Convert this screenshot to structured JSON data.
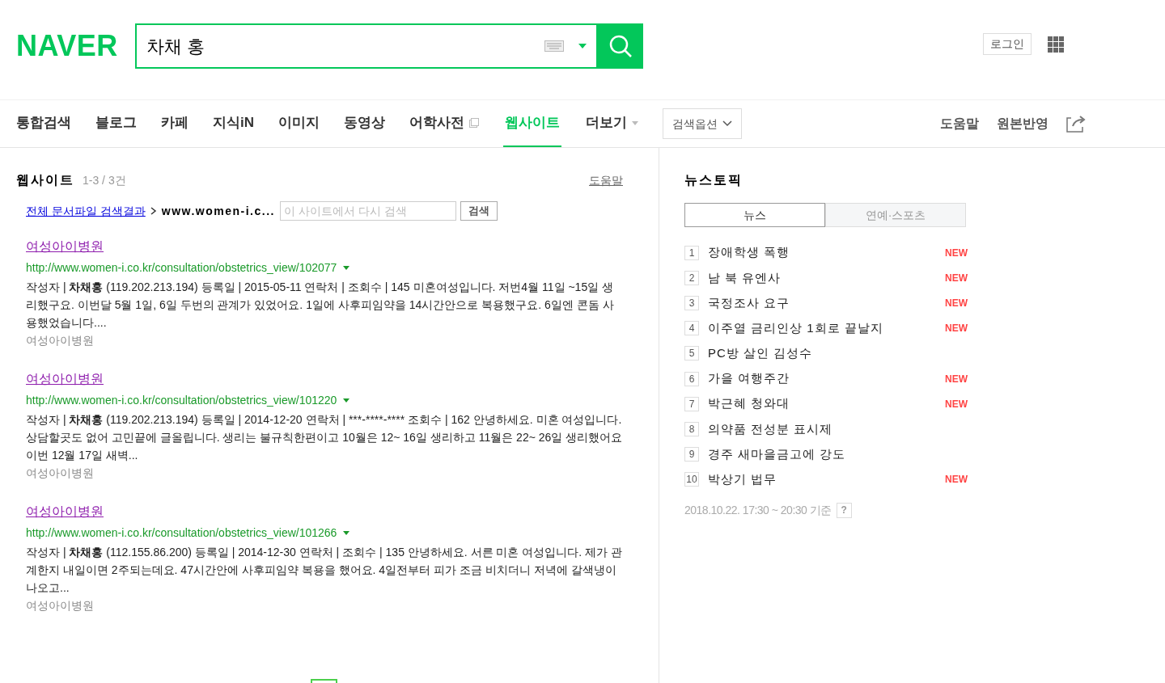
{
  "header": {
    "logo": "NAVER",
    "search_value": "차채 홍",
    "login": "로그인"
  },
  "nav": {
    "tabs": [
      {
        "label": "통합검색",
        "selected": false,
        "kind": "plain"
      },
      {
        "label": "블로그",
        "selected": false,
        "kind": "plain"
      },
      {
        "label": "카페",
        "selected": false,
        "kind": "plain"
      },
      {
        "label": "지식iN",
        "selected": false,
        "kind": "plain"
      },
      {
        "label": "이미지",
        "selected": false,
        "kind": "plain"
      },
      {
        "label": "동영상",
        "selected": false,
        "kind": "plain"
      },
      {
        "label": "어학사전",
        "selected": false,
        "kind": "external"
      },
      {
        "label": "웹사이트",
        "selected": true,
        "kind": "plain"
      },
      {
        "label": "더보기",
        "selected": false,
        "kind": "more"
      }
    ],
    "options_button": "검색옵션",
    "links": [
      "도움말",
      "원본반영"
    ]
  },
  "results": {
    "title": "웹사이트",
    "count": "1-3 / 3건",
    "help": "도움말",
    "breadcrumb_link": "전체 문서파일 검색결과",
    "breadcrumb_site": "www.women-i.c...",
    "site_search_placeholder": "이 사이트에서 다시 검색",
    "site_search_button": "검색",
    "items": [
      {
        "title": "여성아이병원",
        "url": "http://www.women-i.co.kr/consultation/obstetrics_view/102077",
        "snippet_prefix": "작성자 |",
        "author": "차채홍",
        "snippet": "(119.202.213.194) 등록일 | 2015-05-11 연락처 | 조회수 | 145 미혼여성입니다. 저번4월 11일 ~15일 생리했구요. 이번달 5월 1일, 6일 두번의 관계가 있었어요. 1일에 사후피임약을 14시간안으로 복용했구요. 6일엔 콘돔 사용했었습니다....",
        "source": "여성아이병원"
      },
      {
        "title": "여성아이병원",
        "url": "http://www.women-i.co.kr/consultation/obstetrics_view/101220",
        "snippet_prefix": "작성자 |",
        "author": "차채홍",
        "snippet": "(119.202.213.194) 등록일 | 2014-12-20 연락처 | ***-****-**** 조회수 | 162 안녕하세요. 미혼 여성입니다. 상담할곳도 없어 고민끝에 글올립니다. 생리는 불규칙한편이고 10월은 12~ 16일 생리하고 11월은 22~ 26일 생리했어요 이번 12월 17일 새벽...",
        "source": "여성아이병원"
      },
      {
        "title": "여성아이병원",
        "url": "http://www.women-i.co.kr/consultation/obstetrics_view/101266",
        "snippet_prefix": "작성자 |",
        "author": "차채홍",
        "snippet": "(112.155.86.200) 등록일 | 2014-12-30 연락처 | 조회수 | 135 안녕하세요. 서른 미혼 여성입니다. 제가 관계한지 내일이면 2주되는데요. 47시간안에 사후피임약 복용을 했어요. 4일전부터 피가 조금 비치더니 저녁에 갈색냉이 나오고...",
        "source": "여성아이병원"
      }
    ]
  },
  "news_topic": {
    "title": "뉴스토픽",
    "tabs": [
      {
        "label": "뉴스",
        "selected": true
      },
      {
        "label": "연예·스포츠",
        "selected": false
      }
    ],
    "items": [
      {
        "rank": "1",
        "text": "장애학생 폭행",
        "badge": "NEW"
      },
      {
        "rank": "2",
        "text": "남 북 유엔사",
        "badge": "NEW"
      },
      {
        "rank": "3",
        "text": "국정조사 요구",
        "badge": "NEW"
      },
      {
        "rank": "4",
        "text": "이주열 금리인상 1회로 끝날지",
        "badge": "NEW"
      },
      {
        "rank": "5",
        "text": "PC방 살인 김성수"
      },
      {
        "rank": "6",
        "text": "가을 여행주간",
        "badge": "NEW"
      },
      {
        "rank": "7",
        "text": "박근혜 청와대",
        "badge": "NEW"
      },
      {
        "rank": "8",
        "text": "의약품 전성분 표시제"
      },
      {
        "rank": "9",
        "text": "경주 새마을금고에 강도"
      },
      {
        "rank": "10",
        "text": "박상기 법무",
        "badge": "NEW"
      }
    ],
    "timestamp": "2018.10.22. 17:30 ~ 20:30 기준",
    "help_icon": "?"
  }
}
